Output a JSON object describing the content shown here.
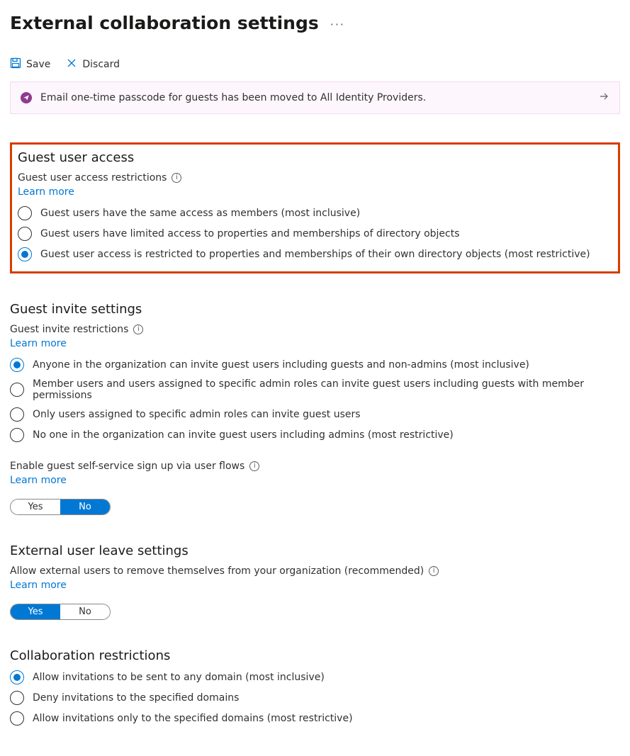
{
  "page": {
    "title": "External collaboration settings",
    "more_menu_label": "..."
  },
  "actions": {
    "save": "Save",
    "discard": "Discard"
  },
  "banner": {
    "text": "Email one-time passcode for guests has been moved to All Identity Providers."
  },
  "sections": {
    "guest_access": {
      "heading": "Guest user access",
      "subheading": "Guest user access restrictions",
      "learn_more": "Learn more",
      "options": [
        "Guest users have the same access as members (most inclusive)",
        "Guest users have limited access to properties and memberships of directory objects",
        "Guest user access is restricted to properties and memberships of their own directory objects (most restrictive)"
      ],
      "selected_index": 2
    },
    "guest_invite": {
      "heading": "Guest invite settings",
      "subheading": "Guest invite restrictions",
      "learn_more": "Learn more",
      "options": [
        "Anyone in the organization can invite guest users including guests and non-admins (most inclusive)",
        "Member users and users assigned to specific admin roles can invite guest users including guests with member permissions",
        "Only users assigned to specific admin roles can invite guest users",
        "No one in the organization can invite guest users including admins (most restrictive)"
      ],
      "selected_index": 0,
      "self_service_label": "Enable guest self-service sign up via user flows",
      "self_service_learn_more": "Learn more",
      "self_service_options": {
        "yes": "Yes",
        "no": "No"
      },
      "self_service_value": "No"
    },
    "external_leave": {
      "heading": "External user leave settings",
      "subheading": "Allow external users to remove themselves from your organization (recommended)",
      "learn_more": "Learn more",
      "options": {
        "yes": "Yes",
        "no": "No"
      },
      "value": "Yes"
    },
    "collab_restrictions": {
      "heading": "Collaboration restrictions",
      "options": [
        "Allow invitations to be sent to any domain (most inclusive)",
        "Deny invitations to the specified domains",
        "Allow invitations only to the specified domains (most restrictive)"
      ],
      "selected_index": 0
    }
  }
}
